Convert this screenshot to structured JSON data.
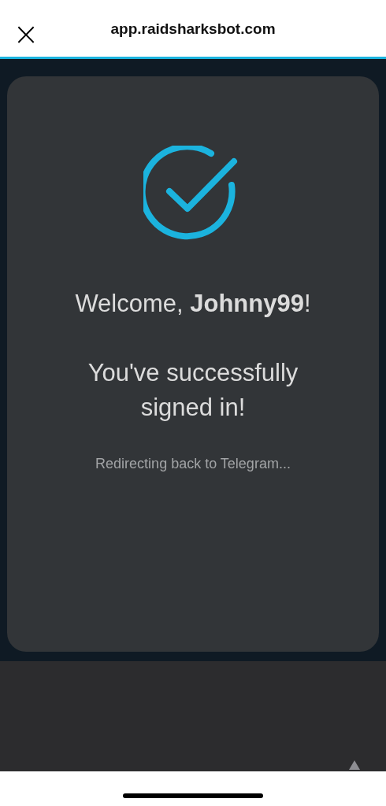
{
  "browser_bar": {
    "close": "×",
    "url": "app.raidsharksbot.com"
  },
  "card": {
    "greeting": "Welcome, **Johnny99**!",
    "message": "You've successfully signed in!",
    "status": "Redirecting back to Telegram..."
  }
}
